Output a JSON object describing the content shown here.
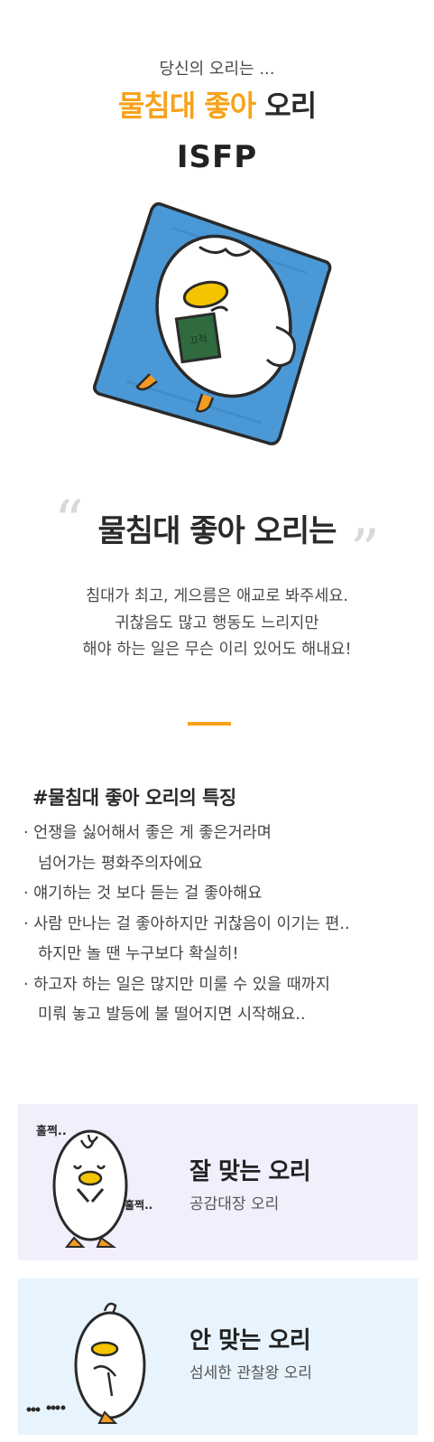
{
  "result": {
    "subtitle": "당신의 오리는 ...",
    "title_highlight": "물침대 좋아",
    "title_rest": " 오리",
    "mbti": "ISFP",
    "book_text": "끄적"
  },
  "quote": {
    "open_mark": "“",
    "close_mark": "”",
    "title": "물침대 좋아 오리는"
  },
  "description": {
    "lines": [
      "침대가 최고, 게으름은 애교로 봐주세요.",
      "귀찮음도 많고 행동도 느리지만",
      "해야 하는 일은 무슨 이리 있어도 해내요!"
    ]
  },
  "features": {
    "title": "#물침대 좋아 오리의 특징",
    "lines": [
      "· 언쟁을 싫어해서 좋은 게 좋은거라며",
      "넘어가는 평화주의자에요",
      "· 얘기하는 것 보다 듣는 걸 좋아해요",
      "· 사람 만나는 걸 좋아하지만 귀찮음이 이기는 편..",
      "하지만 놀 땐 누구보다 확실히!",
      "· 하고자 하는 일은 많지만 미룰 수 있을 때까지",
      "미뤄 놓고 발등에 불 떨어지면 시작해요.."
    ]
  },
  "match_good": {
    "heading": "잘 맞는 오리",
    "name": "공감대장 오리",
    "sfx_top": "훌쩍..",
    "sfx_side": "훌쩍..",
    "bg_color": "#f2eefc"
  },
  "match_bad": {
    "heading": "안 맞는 오리",
    "name": "섬세한 관찰왕 오리",
    "bg_color": "#e8f4fd"
  },
  "colors": {
    "accent": "#f7a21b",
    "blanket": "#4a98d6",
    "beak": "#f5c400"
  }
}
